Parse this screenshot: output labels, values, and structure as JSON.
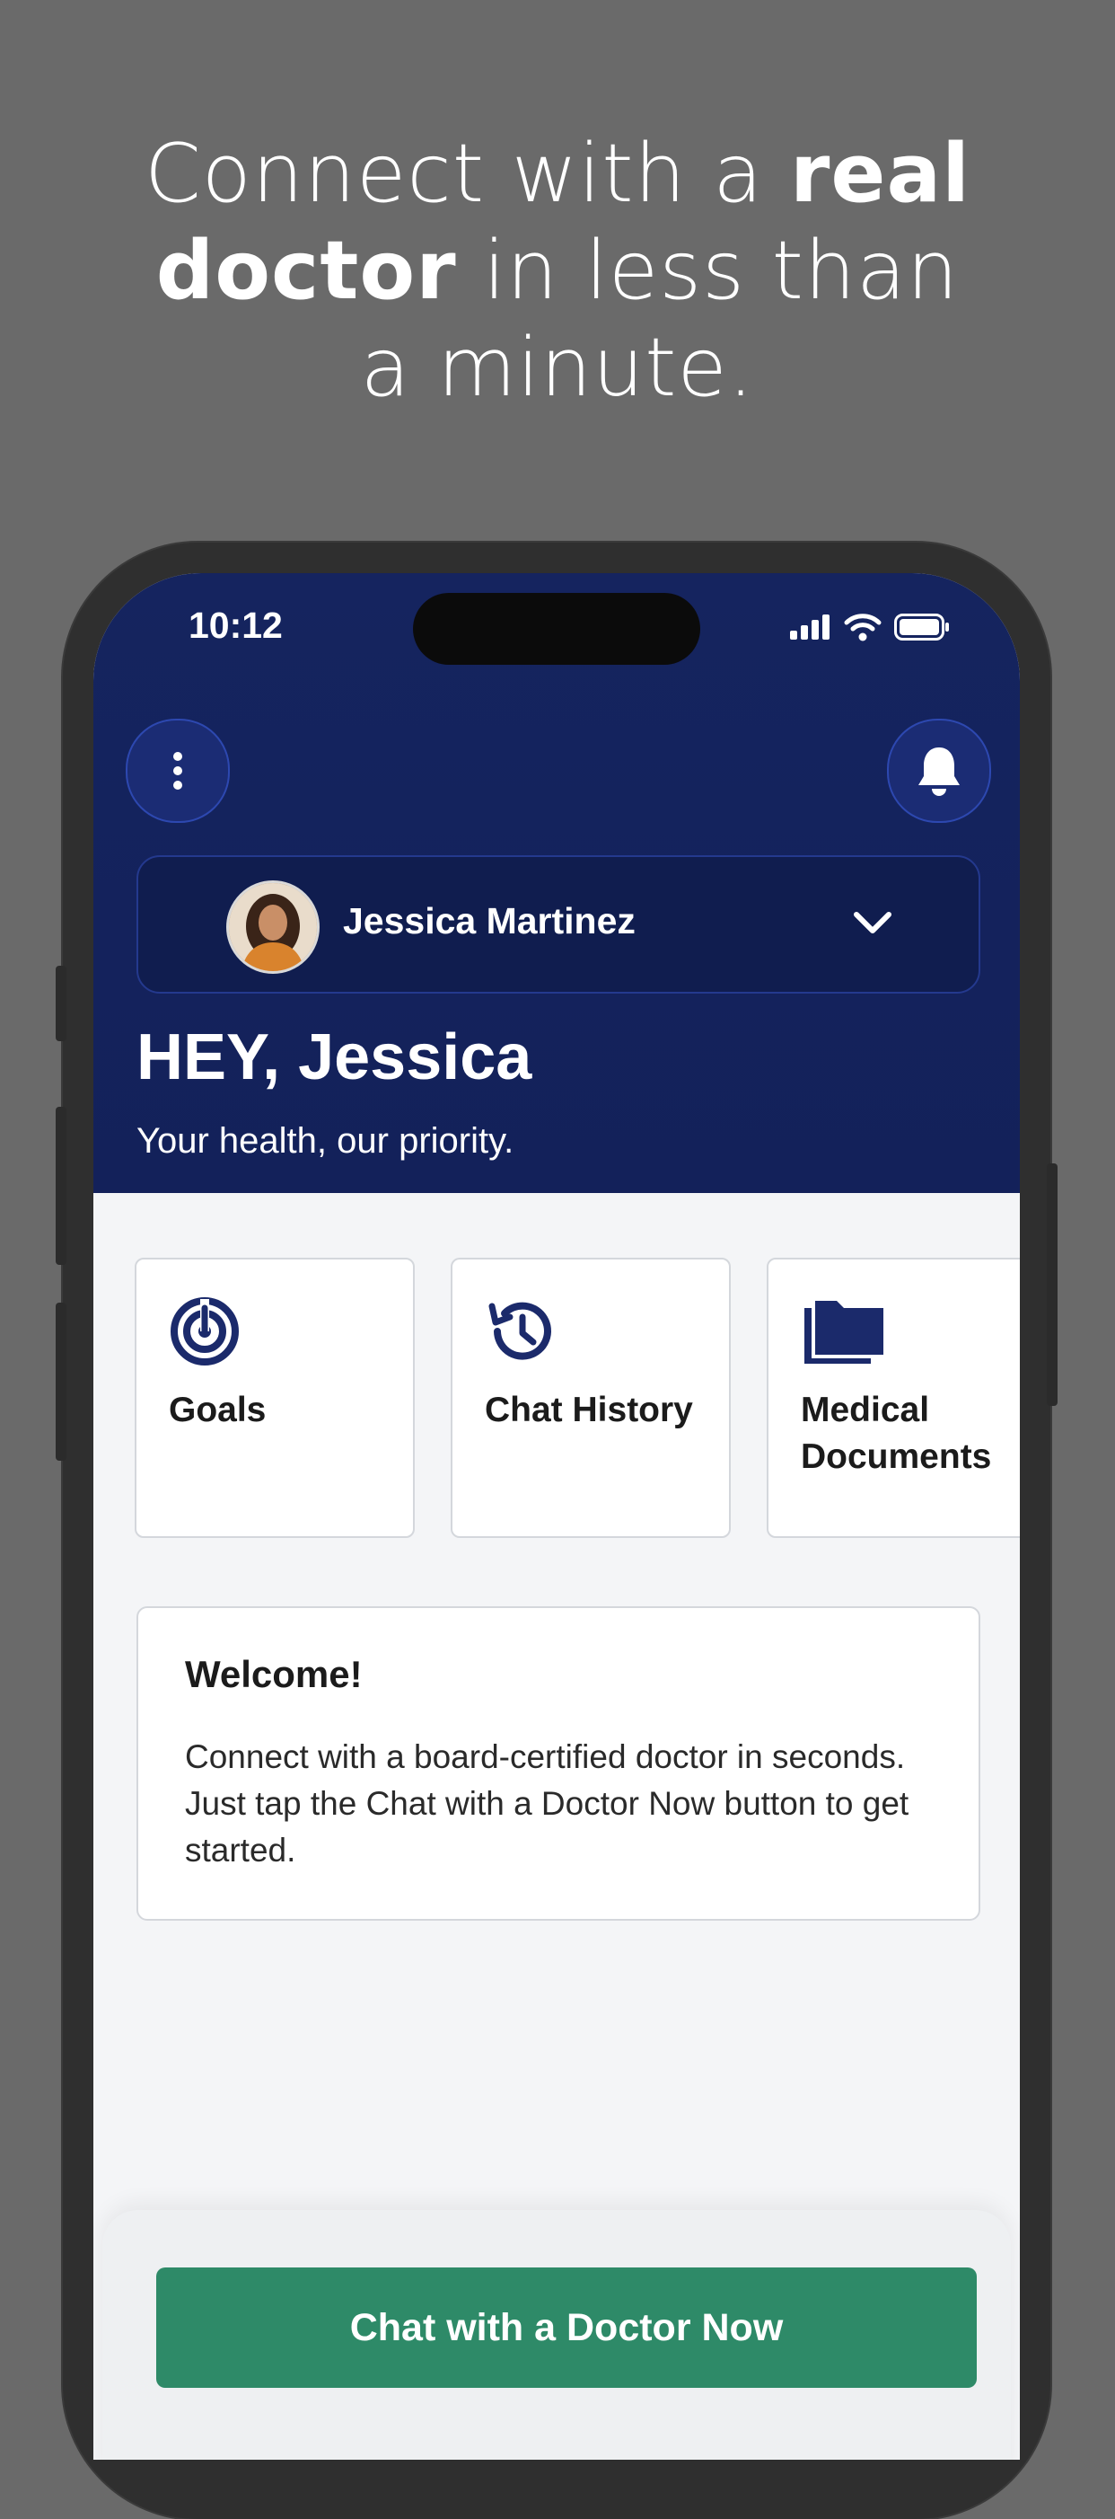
{
  "headline": {
    "line1_pre": "Connect with a ",
    "line1_bold": "real",
    "line2_bold": "doctor",
    "line2_post": " in less than",
    "line3": "a minute."
  },
  "status_bar": {
    "time": "10:12",
    "icons": [
      "cellular-signal-icon",
      "wifi-icon",
      "battery-icon"
    ]
  },
  "header": {
    "menu_icon": "more-vertical-icon",
    "notification_icon": "bell-icon",
    "profile": {
      "name": "Jessica Martinez",
      "dropdown_icon": "chevron-down-icon"
    },
    "greeting": "HEY, Jessica",
    "tagline": "Your health, our priority."
  },
  "quick_actions": [
    {
      "icon": "target-icon",
      "label": "Goals"
    },
    {
      "icon": "history-icon",
      "label": "Chat History"
    },
    {
      "icon": "folder-icon",
      "label": "Medical Documents"
    }
  ],
  "welcome": {
    "title": "Welcome!",
    "body": "Connect with a board-certified doctor in seconds. Just tap the Chat with a Doctor Now button to get started."
  },
  "cta": {
    "label": "Chat with a Doctor Now"
  },
  "colors": {
    "background": "#6a6a6a",
    "header": "#15245f",
    "accent_navy": "#1b2a6b",
    "cta_green": "#2e8a68"
  }
}
